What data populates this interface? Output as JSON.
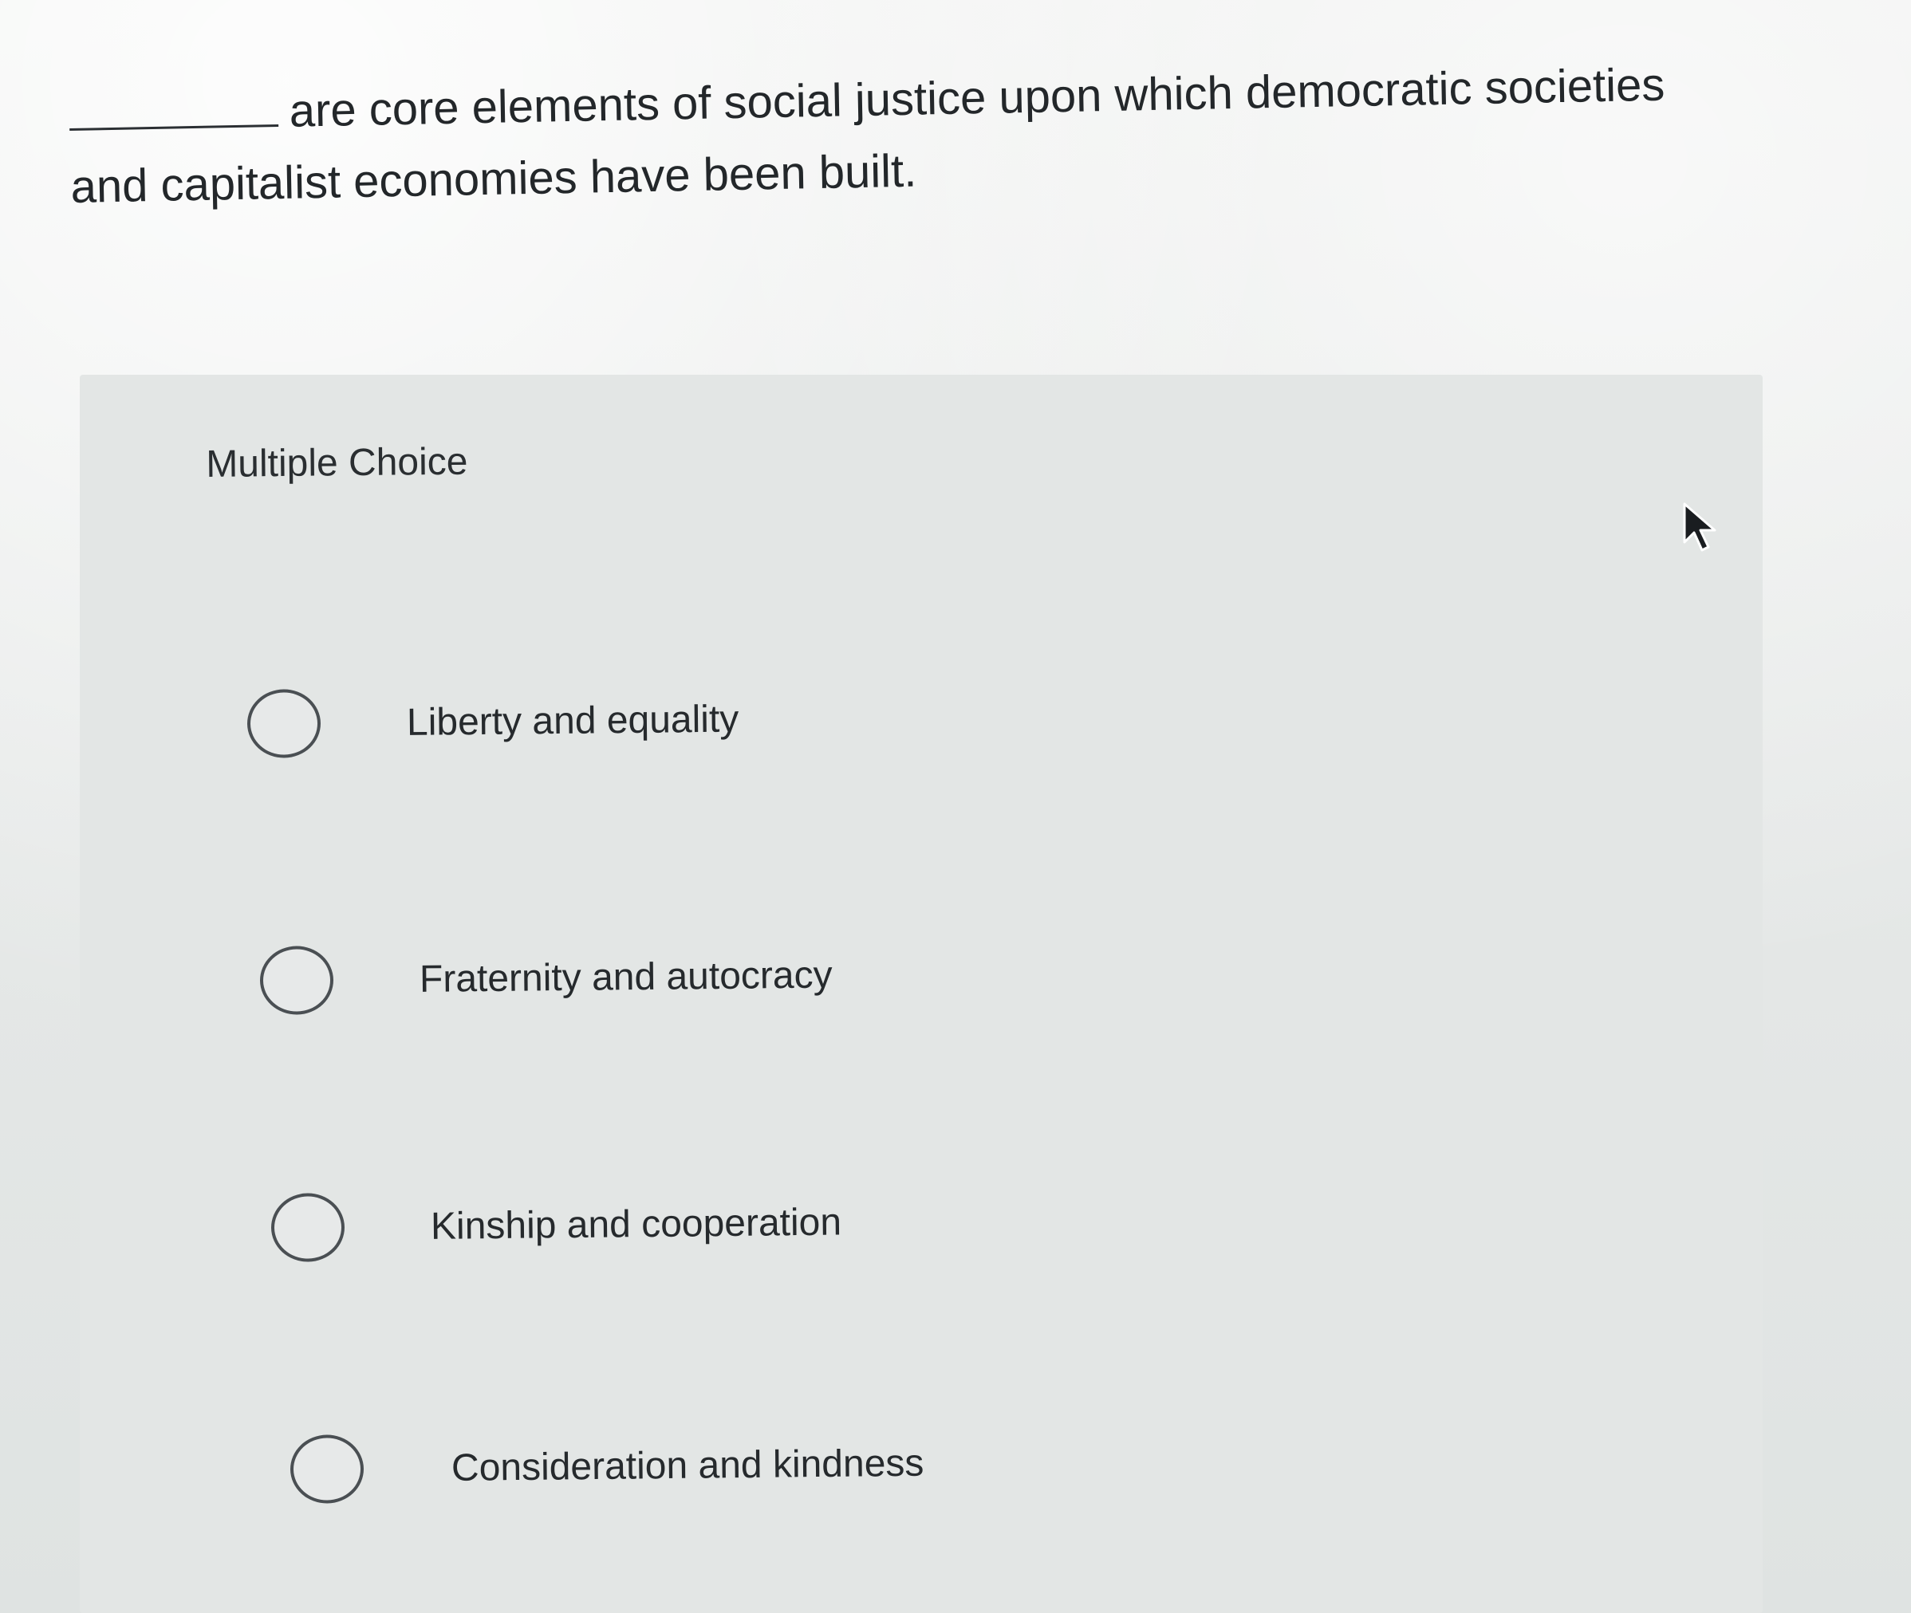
{
  "question": {
    "text": "are core elements of social justice upon which democratic societies and capitalist economies have been built."
  },
  "multiple_choice": {
    "label": "Multiple Choice",
    "options": [
      {
        "label": "Liberty and equality"
      },
      {
        "label": "Fraternity and autocracy"
      },
      {
        "label": "Kinship and cooperation"
      },
      {
        "label": "Consideration and kindness"
      }
    ]
  },
  "icons": {
    "radio": "radio-circle-icon",
    "cursor": "mouse-pointer-icon"
  },
  "colors": {
    "text": "#23272a",
    "radio_border": "#4a4f53",
    "panel_background": "#e3e6e5"
  }
}
